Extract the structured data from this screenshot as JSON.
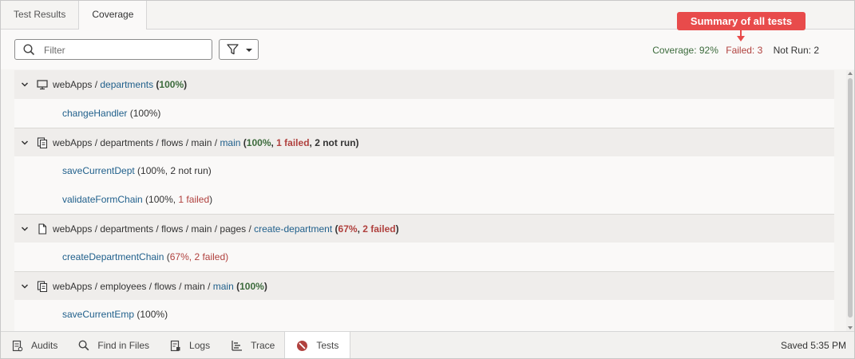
{
  "tabs": [
    {
      "label": "Test Results",
      "active": false
    },
    {
      "label": "Coverage",
      "active": true
    }
  ],
  "filter": {
    "placeholder": "Filter",
    "value": ""
  },
  "callout": {
    "label": "Summary of all tests"
  },
  "summary": {
    "coverage": "Coverage: 92%",
    "failed": "Failed: 3",
    "not_run": "Not Run: 2"
  },
  "colors": {
    "green": "#3c6b3c",
    "red": "#b0413e",
    "link": "#1f5f8b",
    "callout": "#e84b4b"
  },
  "groups": [
    {
      "icon": "monitor-icon",
      "prefix": "webApps / ",
      "link": "departments",
      "stats": [
        {
          "text": " (",
          "cls": "b"
        },
        {
          "text": "100%",
          "cls": "b green"
        },
        {
          "text": ")",
          "cls": "b"
        }
      ],
      "children": [
        {
          "link": "changeHandler",
          "stats": " (100%)"
        }
      ]
    },
    {
      "icon": "flow-icon",
      "prefix": "webApps / departments / flows / main / ",
      "link": "main",
      "stats": [
        {
          "text": " (",
          "cls": "b"
        },
        {
          "text": "100%",
          "cls": "b green"
        },
        {
          "text": ", ",
          "cls": "b"
        },
        {
          "text": "1 failed",
          "cls": "b red"
        },
        {
          "text": ", 2 not run)",
          "cls": "b"
        }
      ],
      "children": [
        {
          "link": "saveCurrentDept",
          "stats": " (100%, 2 not run)"
        },
        {
          "link": "validateFormChain",
          "stats_parts": [
            " (100%, ",
            "1 failed",
            ")"
          ]
        }
      ]
    },
    {
      "icon": "page-icon",
      "prefix": "webApps / departments / flows / main / pages / ",
      "link": "create-department",
      "stats": [
        {
          "text": " (",
          "cls": "b"
        },
        {
          "text": "67%",
          "cls": "b red"
        },
        {
          "text": ", ",
          "cls": "b"
        },
        {
          "text": "2 failed",
          "cls": "b red"
        },
        {
          "text": ")",
          "cls": "b"
        }
      ],
      "children": [
        {
          "link": "createDepartmentChain",
          "stats_parts_red": [
            " (",
            "67%",
            ", ",
            "2 failed",
            ")"
          ]
        }
      ]
    },
    {
      "icon": "flow-icon",
      "prefix": "webApps / employees / flows / main / ",
      "link": "main",
      "stats": [
        {
          "text": " (",
          "cls": "b"
        },
        {
          "text": "100%",
          "cls": "b green"
        },
        {
          "text": ")",
          "cls": "b"
        }
      ],
      "children": [
        {
          "link": "saveCurrentEmp",
          "stats": " (100%)"
        }
      ]
    }
  ],
  "bottom_tabs": [
    {
      "label": "Audits",
      "icon": "audits-icon",
      "active": false
    },
    {
      "label": "Find in Files",
      "icon": "search-icon",
      "active": false
    },
    {
      "label": "Logs",
      "icon": "logs-icon",
      "active": false
    },
    {
      "label": "Trace",
      "icon": "trace-icon",
      "active": false
    },
    {
      "label": "Tests",
      "icon": "tests-icon",
      "active": true
    }
  ],
  "status": {
    "saved": "Saved 5:35 PM"
  }
}
